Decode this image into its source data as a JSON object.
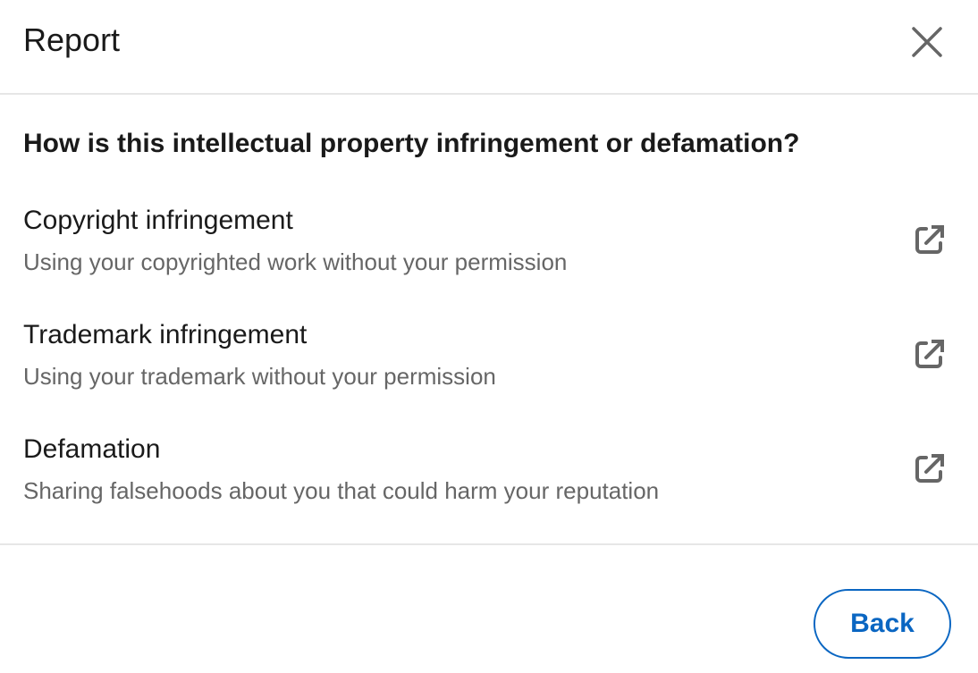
{
  "header": {
    "title": "Report",
    "close_icon": "close-icon"
  },
  "question": "How is this intellectual property infringement or defamation?",
  "options": [
    {
      "title": "Copyright infringement",
      "description": "Using your copyrighted work without your permission",
      "icon": "external-link-icon"
    },
    {
      "title": "Trademark infringement",
      "description": "Using your trademark without your permission",
      "icon": "external-link-icon"
    },
    {
      "title": "Defamation",
      "description": "Sharing falsehoods about you that could harm your reputation",
      "icon": "external-link-icon"
    }
  ],
  "footer": {
    "back_label": "Back"
  },
  "colors": {
    "accent": "#0a66c2",
    "icon": "#666666",
    "divider": "#e6e6e6"
  }
}
